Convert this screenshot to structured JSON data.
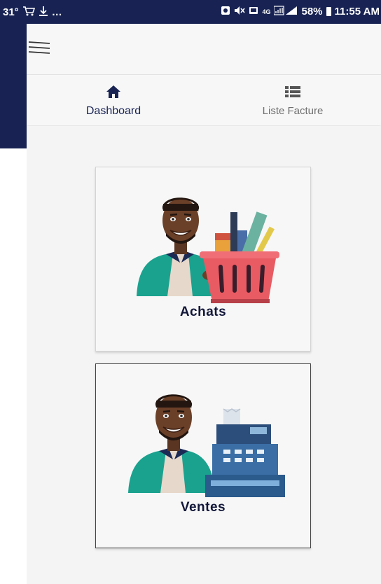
{
  "status_bar": {
    "temperature": "31°",
    "network": "4G",
    "battery": "58%",
    "time": "11:55 AM",
    "ellipsis": "…"
  },
  "tabs": [
    {
      "label": "Dashboard",
      "icon": "home-icon",
      "active": true
    },
    {
      "label": "Liste Facture",
      "icon": "list-icon",
      "active": false
    }
  ],
  "cards": {
    "achats": {
      "label": "Achats",
      "illustration": "man-with-shopping-basket"
    },
    "ventes": {
      "label": "Ventes",
      "illustration": "man-with-cash-register"
    }
  },
  "colors": {
    "primary": "#182353",
    "background": "#f4f4f4",
    "tab_inactive": "#6f6f6f",
    "card_text": "#13183a"
  }
}
